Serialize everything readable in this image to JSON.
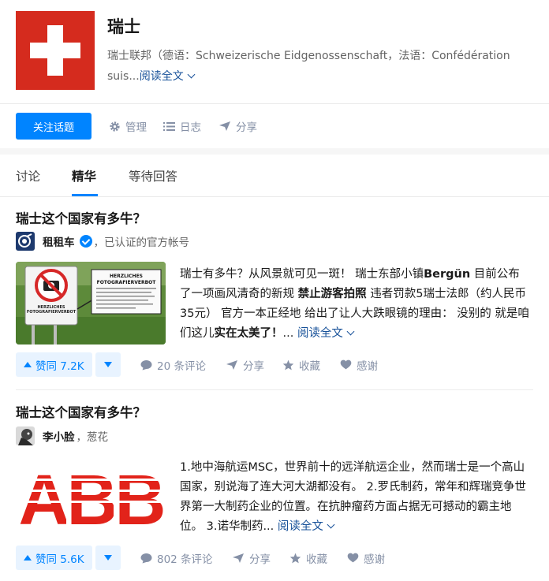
{
  "topic": {
    "title": "瑞士",
    "description": "瑞士联邦（德语：Schweizerische Eidgenossenschaft，法语：Confédération suis...",
    "read_more": "阅读全文",
    "follow_label": "关注话题",
    "tools": [
      {
        "label": "管理",
        "icon": "gear-icon"
      },
      {
        "label": "日志",
        "icon": "list-icon"
      },
      {
        "label": "分享",
        "icon": "share-icon"
      }
    ]
  },
  "tabs": [
    {
      "label": "讨论",
      "active": false
    },
    {
      "label": "精华",
      "active": true
    },
    {
      "label": "等待回答",
      "active": false
    }
  ],
  "feed": [
    {
      "question": "瑞士这个国家有多牛？",
      "author": "租租车",
      "author_sub": "，已认证的官方帐号",
      "verified": true,
      "image_text": {
        "sign_title": "HERZLICHES FOTOGRAFIERVERBOT",
        "sign_small": "HERZLICHES FOTOGRAFIERVERBOT"
      },
      "excerpt_parts": [
        {
          "t": "瑞士有多牛？从风景就可见一斑！ 瑞士东部小镇",
          "b": false
        },
        {
          "t": "Bergün",
          "b": true
        },
        {
          "t": " 目前公布了一项画风清奇的新规 ",
          "b": false
        },
        {
          "t": "禁止游客拍照",
          "b": true
        },
        {
          "t": " 违者罚款5瑞士法郎（约人民币35元） 官方一本正经地 给出了让人大跌眼镜的理由： 没别的 就是咱们这儿",
          "b": false
        },
        {
          "t": "实在太美了！",
          "b": true
        },
        {
          "t": "... ",
          "b": false
        }
      ],
      "read_more": "阅读全文",
      "votes": "赞同 7.2K",
      "comments": "20 条评论",
      "share": "分享",
      "favorite": "收藏",
      "thanks": "感谢"
    },
    {
      "question": "瑞士这个国家有多牛？",
      "author": "李小脸",
      "author_sub": "，葱花",
      "verified": false,
      "image_text": {
        "logo": "ABB"
      },
      "excerpt_parts": [
        {
          "t": "1.地中海航运MSC，世界前十的远洋航运企业，然而瑞士是一个高山国家，别说海了连大河大湖都没有。 2.罗氏制药，常年和辉瑞竞争世界第一大制药企业的位置。在抗肿瘤药方面占据无可撼动的霸主地位。 3.诺华制药... ",
          "b": false
        }
      ],
      "read_more": "阅读全文",
      "votes": "赞同 5.6K",
      "comments": "802 条评论",
      "share": "分享",
      "favorite": "收藏",
      "thanks": "感谢"
    }
  ],
  "colors": {
    "accent": "#0084ff",
    "flag_red": "#d52b1e",
    "link": "#175199",
    "muted": "#8590a6",
    "abb_red": "#e2231a"
  }
}
